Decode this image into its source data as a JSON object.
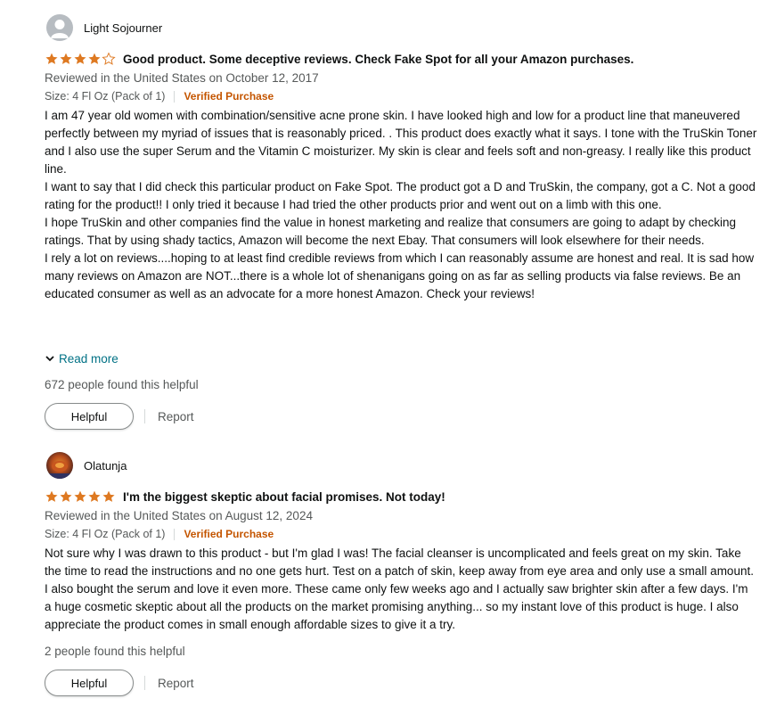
{
  "reviews": [
    {
      "author": "Light Sojourner",
      "rating": 4,
      "title": "Good product. Some deceptive reviews. Check Fake Spot for all your Amazon purchases.",
      "meta": "Reviewed in the United States on October 12, 2017",
      "size": "Size: 4 Fl Oz (Pack of 1)",
      "verified": "Verified Purchase",
      "body": [
        "I am 47 year old women with combination/sensitive acne prone skin. I have looked high and low for a product line that maneuvered perfectly between my myriad of issues that is reasonably priced. . This product does exactly what it says. I tone with the TruSkin Toner and I also use the super Serum and the Vitamin C moisturizer. My skin is clear and feels soft and non-greasy. I really like this product line.",
        "I want to say that I did check this particular product on Fake Spot. The product got a D and TruSkin, the company, got a C. Not a good rating for the product!! I only tried it because I had tried the other products prior and went out on a limb with this one.",
        "I hope TruSkin and other companies find the value in honest marketing and realize that consumers are going to adapt by checking ratings. That by using shady tactics, Amazon will become the next Ebay. That consumers will look elsewhere for their needs.",
        "I rely a lot on reviews....hoping to at least find credible reviews from which I can reasonably assume are honest and real. It is sad how many reviews on Amazon are NOT...there is a whole lot of shenanigans going on as far as selling products via false reviews. Be an educated consumer as well as an advocate for a more honest Amazon. Check your reviews!"
      ],
      "read_more": "Read more",
      "helpful_count": "672 people found this helpful",
      "helpful_button": "Helpful",
      "report": "Report"
    },
    {
      "author": "Olatunja",
      "rating": 5,
      "title": "I'm the biggest skeptic about facial promises. Not today!",
      "meta": "Reviewed in the United States on August 12, 2024",
      "size": "Size: 4 Fl Oz (Pack of 1)",
      "verified": "Verified Purchase",
      "body": [
        "Not sure why I was drawn to this product - but I'm glad I was! The facial cleanser is uncomplicated and feels great on my skin. Take the time to read the instructions and no one gets hurt. Test on a patch of skin, keep away from eye area and only use a small amount. I also bought the serum and love it even more. These came only few weeks ago and I actually saw brighter skin after a few days. I'm a huge cosmetic skeptic about all the products on the market promising anything... so my instant love of this product is huge. I also appreciate the product comes in small enough affordable sizes to give it a try."
      ],
      "helpful_count": "2 people found this helpful",
      "helpful_button": "Helpful",
      "report": "Report"
    }
  ],
  "colors": {
    "star": "#de7921",
    "link": "#007185",
    "verified": "#c45500",
    "muted": "#565959"
  },
  "icons": {
    "avatar_default": "person-silhouette-icon",
    "star_full": "star-filled-icon",
    "star_empty": "star-outline-icon",
    "chevron": "chevron-down-icon"
  }
}
